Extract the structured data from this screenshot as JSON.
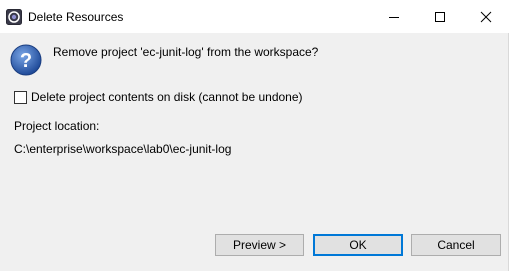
{
  "window": {
    "title": "Delete Resources",
    "icon": "eclipse-app-icon"
  },
  "title_controls": [
    "minimize-icon",
    "maximize-icon",
    "close-icon"
  ],
  "dialog": {
    "icon": "question-icon",
    "message": "Remove project 'ec-junit-log' from the workspace?",
    "checkbox": {
      "label": "Delete project contents on disk (cannot be undone)",
      "checked": false
    },
    "location_label": "Project location:",
    "location_value": "C:\\enterprise\\workspace\\lab0\\ec-junit-log"
  },
  "buttons": {
    "preview": "Preview >",
    "ok": "OK",
    "cancel": "Cancel"
  },
  "colors": {
    "dialog_bg": "#f0f0f0",
    "titlebar_bg": "#ffffff",
    "default_button_border": "#0078d7",
    "question_icon_blue": "#2f5ea8"
  }
}
